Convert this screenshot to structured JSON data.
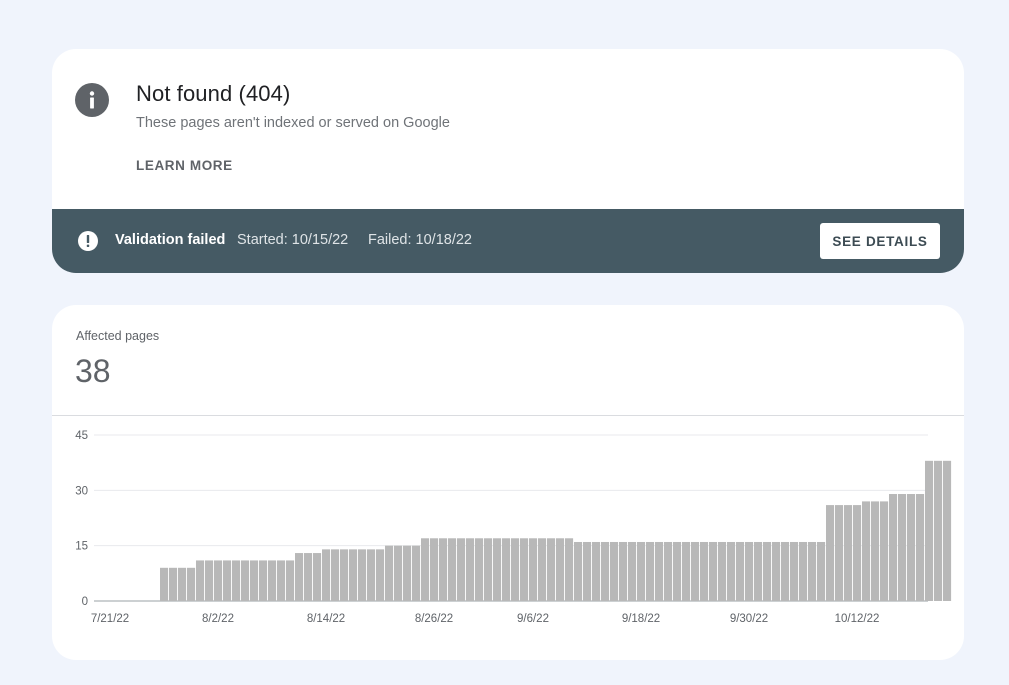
{
  "issue": {
    "title": "Not found (404)",
    "subtitle": "These pages aren't indexed or served on Google",
    "learn_more": "LEARN MORE",
    "icon": "info-icon"
  },
  "validation": {
    "status": "Validation failed",
    "started": "Started: 10/15/22",
    "failed": "Failed: 10/18/22",
    "button": "SEE DETAILS",
    "icon": "warning-icon"
  },
  "colors": {
    "page_bg": "#f0f4fc",
    "banner_bg": "#455a64",
    "bar": "#b8b8b8"
  },
  "metric": {
    "label": "Affected pages",
    "value": "38"
  },
  "chart_data": {
    "type": "bar",
    "ylim": [
      0,
      45
    ],
    "yticks": [
      0,
      15,
      30,
      45
    ],
    "grid": true,
    "xtick_labels": [
      {
        "label": "7/21/22",
        "index": 0
      },
      {
        "label": "8/2/22",
        "index": 12
      },
      {
        "label": "8/14/22",
        "index": 24
      },
      {
        "label": "8/26/22",
        "index": 36
      },
      {
        "label": "9/6/22",
        "index": 47
      },
      {
        "label": "9/18/22",
        "index": 59
      },
      {
        "label": "9/30/22",
        "index": 71
      },
      {
        "label": "10/12/22",
        "index": 83
      }
    ],
    "values": [
      0,
      0,
      0,
      0,
      9,
      9,
      9,
      9,
      11,
      11,
      11,
      11,
      11,
      11,
      11,
      11,
      11,
      11,
      11,
      13,
      13,
      13,
      14,
      14,
      14,
      14,
      14,
      14,
      14,
      15,
      15,
      15,
      15,
      17,
      17,
      17,
      17,
      17,
      17,
      17,
      17,
      17,
      17,
      17,
      17,
      17,
      17,
      17,
      17,
      17,
      16,
      16,
      16,
      16,
      16,
      16,
      16,
      16,
      16,
      16,
      16,
      16,
      16,
      16,
      16,
      16,
      16,
      16,
      16,
      16,
      16,
      16,
      16,
      16,
      16,
      16,
      16,
      16,
      26,
      26,
      26,
      26,
      27,
      27,
      27,
      29,
      29,
      29,
      29,
      38,
      38,
      38
    ]
  }
}
